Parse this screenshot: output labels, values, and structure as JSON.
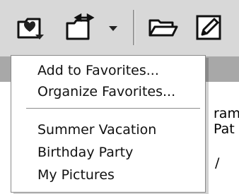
{
  "toolbar": {
    "buttons": [
      {
        "icon": "favorites-heart-icon"
      },
      {
        "icon": "organize-favorites-icon"
      },
      {
        "icon": "dropdown-arrow-icon"
      },
      {
        "icon": "open-folder-icon"
      },
      {
        "icon": "edit-pencil-icon"
      }
    ]
  },
  "background": {
    "fragments": [
      "ram",
      "Pat",
      "/"
    ]
  },
  "menu": {
    "actions": [
      "Add to Favorites...",
      "Organize Favorites..."
    ],
    "favorites": [
      "Summer Vacation",
      "Birthday Party",
      "My Pictures"
    ]
  }
}
